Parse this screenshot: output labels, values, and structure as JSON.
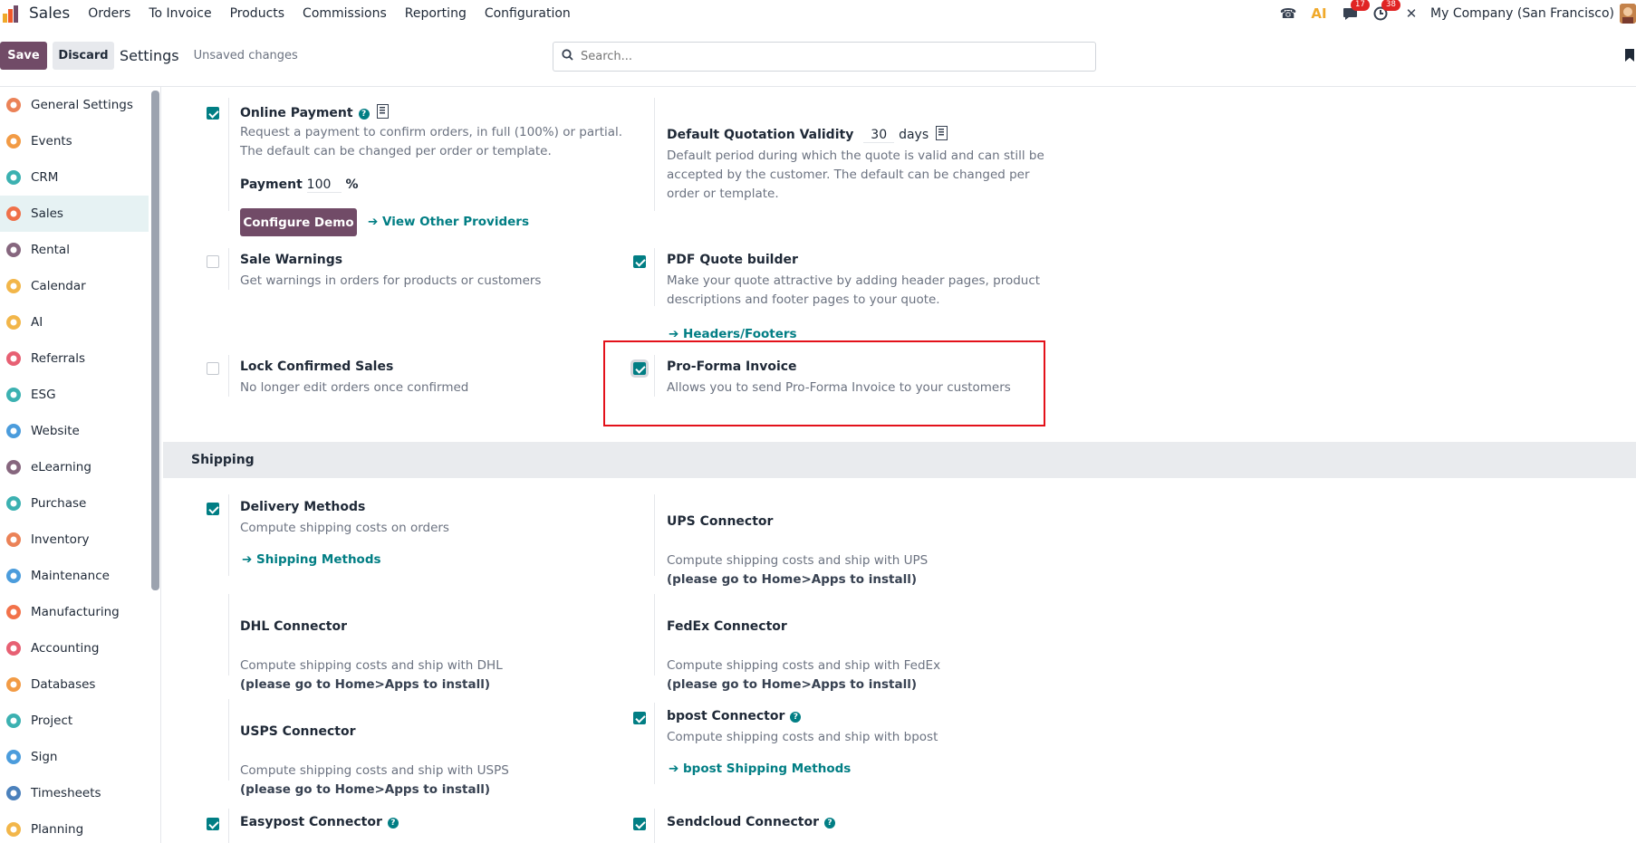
{
  "topbar": {
    "app_title": "Sales",
    "menu": [
      "Orders",
      "To Invoice",
      "Products",
      "Commissions",
      "Reporting",
      "Configuration"
    ],
    "messages_badge": "17",
    "activities_badge": "38",
    "company": "My Company (San Francisco)"
  },
  "control": {
    "save_label": "Save",
    "discard_label": "Discard",
    "title": "Settings",
    "unsaved": "Unsaved changes",
    "search_placeholder": "Search..."
  },
  "sidebar": {
    "items": [
      {
        "label": "General Settings",
        "icon": "general-settings-icon",
        "color": "#e86c3a"
      },
      {
        "label": "Events",
        "icon": "events-icon",
        "color": "#f08a24"
      },
      {
        "label": "CRM",
        "icon": "crm-icon",
        "color": "#1aa3a3"
      },
      {
        "label": "Sales",
        "icon": "sales-icon",
        "color": "#f0592a",
        "active": true
      },
      {
        "label": "Rental",
        "icon": "rental-icon",
        "color": "#714b67"
      },
      {
        "label": "Calendar",
        "icon": "calendar-icon",
        "color": "#f0a92a"
      },
      {
        "label": "AI",
        "icon": "ai-icon",
        "color": "#f0a92a"
      },
      {
        "label": "Referrals",
        "icon": "referrals-icon",
        "color": "#e3445a"
      },
      {
        "label": "ESG",
        "icon": "esg-icon",
        "color": "#1aa3a3"
      },
      {
        "label": "Website",
        "icon": "website-icon",
        "color": "#2c8bd6"
      },
      {
        "label": "eLearning",
        "icon": "elearning-icon",
        "color": "#714b67"
      },
      {
        "label": "Purchase",
        "icon": "purchase-icon",
        "color": "#1aa3a3"
      },
      {
        "label": "Inventory",
        "icon": "inventory-icon",
        "color": "#e86c3a"
      },
      {
        "label": "Maintenance",
        "icon": "maintenance-icon",
        "color": "#2c8bd6"
      },
      {
        "label": "Manufacturing",
        "icon": "manufacturing-icon",
        "color": "#f0592a"
      },
      {
        "label": "Accounting",
        "icon": "accounting-icon",
        "color": "#e3445a"
      },
      {
        "label": "Databases",
        "icon": "databases-icon",
        "color": "#f08a24"
      },
      {
        "label": "Project",
        "icon": "project-icon",
        "color": "#1aa3a3"
      },
      {
        "label": "Sign",
        "icon": "sign-icon",
        "color": "#2c8bd6"
      },
      {
        "label": "Timesheets",
        "icon": "timesheets-icon",
        "color": "#2c6bb0"
      },
      {
        "label": "Planning",
        "icon": "planning-icon",
        "color": "#f0a92a"
      }
    ]
  },
  "settings": {
    "online_payment": {
      "title": "Online Payment",
      "desc1": "Request a payment to confirm orders, in full (100%) or partial.",
      "desc2": "The default can be changed per order or template.",
      "payment_label": "Payment",
      "payment_value": "100",
      "payment_unit": "%",
      "configure_label": "Configure Demo",
      "providers_link": "View Other Providers"
    },
    "quotation_validity": {
      "title": "Default Quotation Validity",
      "value": "30",
      "unit": "days",
      "desc1": "Default period during which the quote is valid and can still be",
      "desc2": "accepted by the customer. The default can be changed per",
      "desc3": "order or template."
    },
    "sale_warnings": {
      "title": "Sale Warnings",
      "desc": "Get warnings in orders for products or customers"
    },
    "pdf_quote": {
      "title": "PDF Quote builder",
      "desc1": "Make your quote attractive by adding header pages, product",
      "desc2": "descriptions and footer pages to your quote.",
      "link": "Headers/Footers"
    },
    "lock_sales": {
      "title": "Lock Confirmed Sales",
      "desc": "No longer edit orders once confirmed"
    },
    "proforma": {
      "title": "Pro-Forma Invoice",
      "desc": "Allows you to send Pro-Forma Invoice to your customers"
    }
  },
  "shipping": {
    "section_title": "Shipping",
    "delivery": {
      "title": "Delivery Methods",
      "desc": "Compute shipping costs on orders",
      "link": "Shipping Methods"
    },
    "ups": {
      "title": "UPS Connector",
      "desc": "Compute shipping costs and ship with UPS",
      "note": "(please go to Home>Apps to install)"
    },
    "dhl": {
      "title": "DHL Connector",
      "desc": "Compute shipping costs and ship with DHL",
      "note": "(please go to Home>Apps to install)"
    },
    "fedex": {
      "title": "FedEx Connector",
      "desc": "Compute shipping costs and ship with FedEx",
      "note": "(please go to Home>Apps to install)"
    },
    "usps": {
      "title": "USPS Connector",
      "desc": "Compute shipping costs and ship with USPS",
      "note": "(please go to Home>Apps to install)"
    },
    "bpost": {
      "title": "bpost Connector",
      "desc": "Compute shipping costs and ship with bpost",
      "link": "bpost Shipping Methods"
    },
    "easypost": {
      "title": "Easypost Connector"
    },
    "sendcloud": {
      "title": "Sendcloud Connector"
    }
  },
  "colors": {
    "brand": "#714b67",
    "teal": "#017e84",
    "highlight": "#e3111a"
  }
}
